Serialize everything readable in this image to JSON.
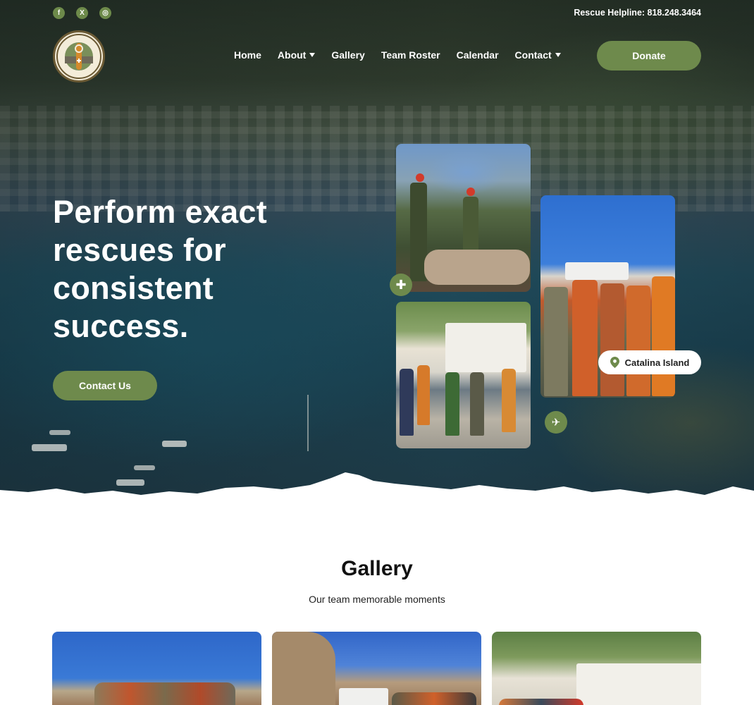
{
  "topbar": {
    "social": [
      {
        "name": "facebook-icon",
        "glyph": "f"
      },
      {
        "name": "x-twitter-icon",
        "glyph": "X"
      },
      {
        "name": "instagram-icon",
        "glyph": "◎"
      }
    ],
    "helpline": "Rescue Helpline: 818.248.3464"
  },
  "nav": {
    "items": [
      {
        "label": "Home",
        "dropdown": false
      },
      {
        "label": "About",
        "dropdown": true
      },
      {
        "label": "Gallery",
        "dropdown": false
      },
      {
        "label": "Team Roster",
        "dropdown": false
      },
      {
        "label": "Calendar",
        "dropdown": false
      },
      {
        "label": "Contact",
        "dropdown": true
      }
    ],
    "donate_label": "Donate"
  },
  "hero": {
    "headline": "Perform exact rescues for consistent success.",
    "cta_label": "Contact Us",
    "location_label": "Catalina Island"
  },
  "gallery": {
    "title": "Gallery",
    "subtitle": "Our team memorable moments"
  },
  "colors": {
    "accent": "#6e8a4c",
    "text_dark": "#111111",
    "white": "#ffffff"
  }
}
